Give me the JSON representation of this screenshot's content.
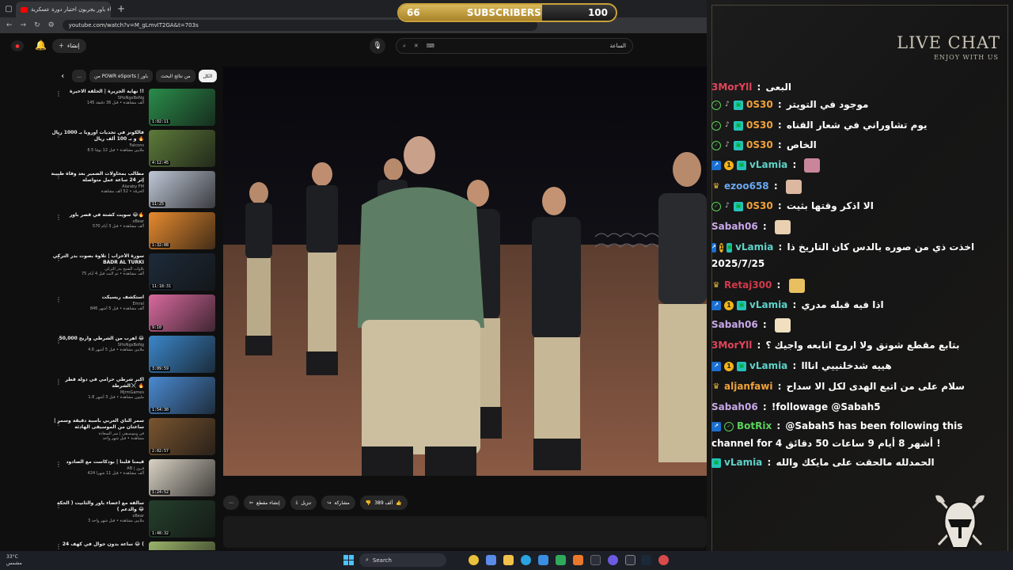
{
  "browser": {
    "tab_title": "اعضاء باور يجربون اختبار دورة عسكرية !",
    "url": "youtube.com/watch?v=M_gLmvIT2GA&t=703s"
  },
  "subscriber_goal": {
    "current": "66",
    "label": "SUBSCRIBERS",
    "target": "100",
    "progress": 0.66
  },
  "youtube_header": {
    "create_label": "إنشاء",
    "search_query": "الساعة"
  },
  "chips": [
    {
      "label": "الكل",
      "active": true
    },
    {
      "label": "من نتائج البحث",
      "active": false
    },
    {
      "label": "من POWR eSports | باور",
      "active": false
    },
    {
      "label": "...",
      "active": false
    }
  ],
  "related": [
    {
      "title": "نهاية الجزيرة | الحلقة الاخيرة !!",
      "channel": "SHoNgxBoNg",
      "stats": "145 ألف مشاهدة • قبل 36 دقيقة",
      "duration": "1:02:11",
      "color": "#2a8c4a"
    },
    {
      "title": "فالكونز في تحديات أوروبا بـ 1000 ريال و بـ 100 ألف ريال 🔥",
      "channel": "Falcons",
      "stats": "8.5 ملايين مشاهدة • قبل 12 يومًا",
      "duration": "4:12:45",
      "color": "#5d7b3a"
    },
    {
      "title": "مطالب بمحاولات الضمير بعد وفاة طبيبة إثر 24 ساعة عمل متواصلة",
      "channel": "Alaraby FM",
      "stats": "الحرفة • 52 ألف مشاهدة",
      "duration": "11:25",
      "color": "#bfc7d6"
    },
    {
      "title": "سويت كشتة في قصر باور 😂🔥",
      "channel": "xBear",
      "stats": "570 ألف مشاهدة • قبل 3 أيام",
      "duration": "1:32:08",
      "color": "#e68a2e"
    },
    {
      "title": "سورة الأحزاب | تلاوة بصوت بدر التركي BADR AL TURKI",
      "channel": "تلاوات الشيخ بدر التركي",
      "stats": "75 ألف مشاهدة • تم البث قبل 4 أيام",
      "duration": "11:18:31",
      "color": "#1d2b3a"
    },
    {
      "title": "استكشف ريسيكت",
      "channel": "Emral",
      "stats": "846 ألف مشاهدة • قبل 5 أشهر",
      "duration": "9:10",
      "color": "#d86a9e"
    },
    {
      "title": "اهرب من الشرطي واربح 50,000 😂",
      "channel": "SHoNgxBoNg",
      "stats": "4.6 ملايين مشاهدة • قبل 5 أشهر",
      "duration": "3:09:59",
      "color": "#3b86c9"
    },
    {
      "title": "اكبر شرطي حرامي في دولة قطر ⚔️الشرطة 🔥",
      "channel": "MjrmGames",
      "stats": "1.8 مليون مشاهدة • قبل 3 أشهر",
      "duration": "1:54:30",
      "color": "#4a8ad1"
    },
    {
      "title": "سمر الناي العربي بأسبة دقيقة وسمر | ساعتان من الموسيقى الهادئة",
      "channel": "فن وموسيقى | سر السعادة",
      "stats": "مشاهدة • قبل شهر واحد",
      "duration": "2:02:57",
      "color": "#7a5530"
    },
    {
      "title": "قيمنا قلبنا | بودكاست مع الصادود",
      "channel": "AB | قروز",
      "stats": "424 ألف مشاهدة • قبل 11 شهرا",
      "duration": "1:24:52",
      "color": "#d9d2c4"
    },
    {
      "title": "سالفة مع اعضاء باور والثانيت ( الحكة والدعم ) 😂",
      "channel": "xBear",
      "stats": "3 ملايين مشاهدة • قبل شهر واحد",
      "duration": "1:48:32",
      "color": "#243f2c"
    },
    {
      "title": "24 ساعة بدون جوال في كهف 😂 (",
      "channel": "",
      "stats": "",
      "duration": "",
      "color": "#9ab46a"
    }
  ],
  "video_actions": {
    "like_count": "389 ألف",
    "share": "مشاركة",
    "download": "تنزيل",
    "clip": "إنشاء مقطع"
  },
  "chat": {
    "title": "LIVE CHAT",
    "subtitle": "ENJOY WITH US",
    "messages": [
      {
        "user": "3MorYll",
        "color": "#e0455a",
        "badges": [],
        "text": "البعى"
      },
      {
        "user": "0S30",
        "color": "#f0a23a",
        "badges": [
          "check",
          "mic",
          "sub"
        ],
        "text": "موجود في التويتر"
      },
      {
        "user": "0S30",
        "color": "#f0a23a",
        "badges": [
          "check",
          "mic",
          "sub"
        ],
        "text": "يوم تشاوراني في شعار القناه"
      },
      {
        "user": "0S30",
        "color": "#f0a23a",
        "badges": [
          "check",
          "mic",
          "sub"
        ],
        "text": "الخاص"
      },
      {
        "user": "vLamia",
        "color": "#5fd2c8",
        "badges": [
          "prime",
          "one",
          "sub"
        ],
        "text": "",
        "emote": "#c9869a"
      },
      {
        "user": "ezoo658",
        "color": "#6aa8f0",
        "badges": [
          "crown"
        ],
        "text": "",
        "emote": "#ddb8a0"
      },
      {
        "user": "0S30",
        "color": "#f0a23a",
        "badges": [
          "check",
          "mic",
          "sub"
        ],
        "text": "الا اذكر وقتها بثيت"
      },
      {
        "user": "Sabah06",
        "color": "#c8a8e8",
        "badges": [],
        "text": "",
        "emote": "#e8d0b0"
      },
      {
        "user": "vLamia",
        "color": "#5fd2c8",
        "badges": [
          "prime",
          "one",
          "sub"
        ],
        "text": "اخذت ذي من صوره بالدس كان التاريخ ذا"
      },
      {
        "user": "",
        "color": "#fff",
        "badges": [],
        "text": "2025/7/25"
      },
      {
        "user": "Retaj300",
        "color": "#d23a4a",
        "badges": [
          "crown"
        ],
        "text": "",
        "emote": "#e8c060"
      },
      {
        "user": "vLamia",
        "color": "#5fd2c8",
        "badges": [
          "prime",
          "one",
          "sub"
        ],
        "text": "اذا فيه قبله مدري"
      },
      {
        "user": "Sabah06",
        "color": "#c8a8e8",
        "badges": [],
        "text": "",
        "emote": "#f0e0c0"
      },
      {
        "user": "3MorYll",
        "color": "#e0455a",
        "badges": [],
        "text": "بتابع مقطع شونق ولا اروح اتابعه واجيك ؟"
      },
      {
        "user": "vLamia",
        "color": "#5fd2c8",
        "badges": [
          "prime",
          "one",
          "sub"
        ],
        "text": "هييه شدخلنييي انااا"
      },
      {
        "user": "aljanfawi",
        "color": "#f0a23a",
        "badges": [
          "crown"
        ],
        "text": "سلام على من اتبع الهدى لكل الا سداح"
      },
      {
        "user": "Sabah06",
        "color": "#c8a8e8",
        "badges": [],
        "text": "!followage @Sabah5"
      },
      {
        "user": "BotRix",
        "color": "#5bd15b",
        "badges": [
          "prime",
          "check"
        ],
        "text": "@Sabah5 has been following this"
      },
      {
        "user": "",
        "color": "#fff",
        "badges": [],
        "text": "channel for 4 أشهر 8 أيام 9 ساعات 50 دقائق !"
      },
      {
        "user": "vLamia",
        "color": "#5fd2c8",
        "badges": [
          "sub"
        ],
        "text": "الحمدلله مالحقت على مايكك والله"
      }
    ]
  },
  "taskbar": {
    "temp": "33°C",
    "weather": "مشمس",
    "search": "Search"
  }
}
